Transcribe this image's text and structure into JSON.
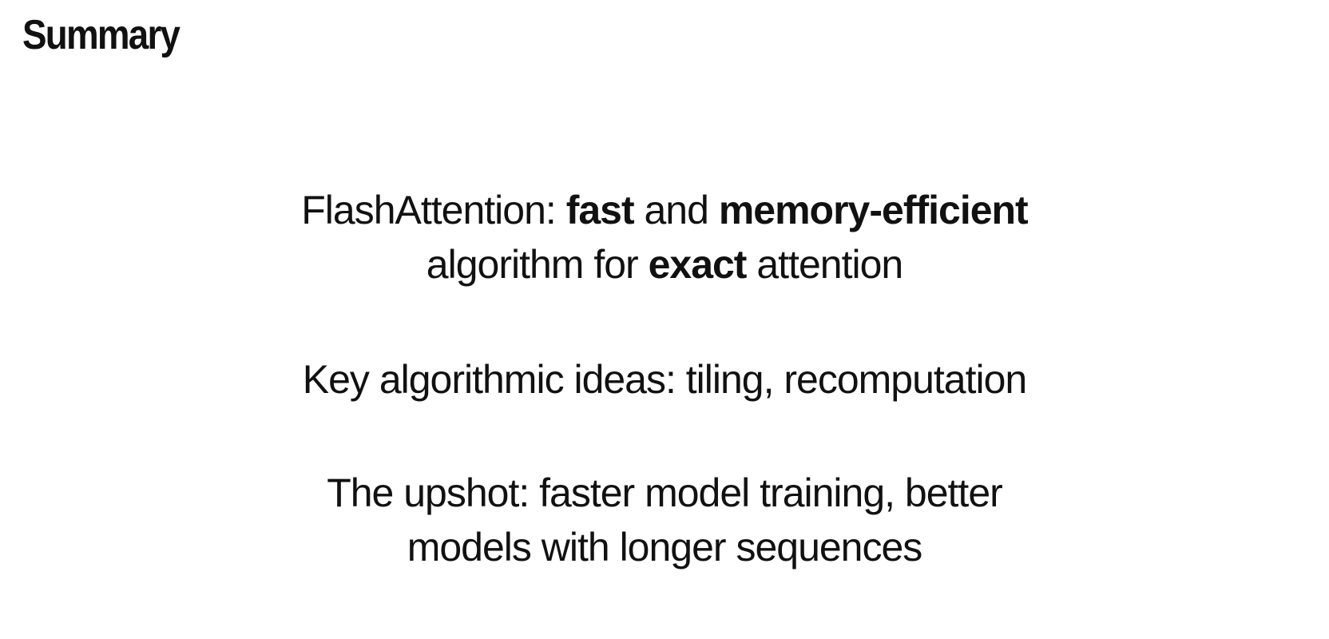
{
  "title": "Summary",
  "p1": {
    "a": "FlashAttention: ",
    "b": "fast",
    "c": " and ",
    "d": "memory-efficient",
    "e": "algorithm for ",
    "f": "exact",
    "g": " attention"
  },
  "p2": "Key algorithmic ideas: tiling, recomputation",
  "p3": {
    "l1": "The upshot: faster model training, better",
    "l2": "models with longer sequences"
  }
}
